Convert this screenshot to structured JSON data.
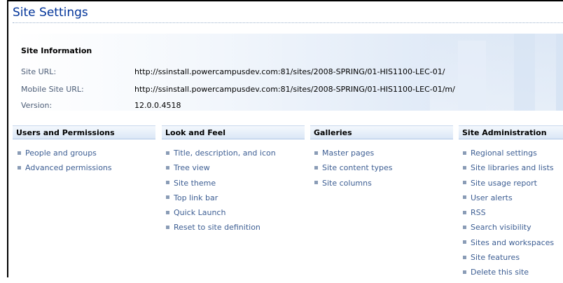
{
  "page": {
    "title": "Site Settings"
  },
  "site_information": {
    "heading": "Site Information",
    "rows": [
      {
        "label": "Site URL:",
        "value": "http://ssinstall.powercampusdev.com:81/sites/2008-SPRING/01-HIS1100-LEC-01/"
      },
      {
        "label": "Mobile Site URL:",
        "value": "http://ssinstall.powercampusdev.com:81/sites/2008-SPRING/01-HIS1100-LEC-01/m/"
      },
      {
        "label": "Version:",
        "value": "12.0.0.4518"
      }
    ]
  },
  "sections": [
    {
      "title": "Users and Permissions",
      "links": [
        "People and groups",
        "Advanced permissions"
      ]
    },
    {
      "title": "Look and Feel",
      "links": [
        "Title, description, and icon",
        "Tree view",
        "Site theme",
        "Top link bar",
        "Quick Launch",
        "Reset to site definition"
      ]
    },
    {
      "title": "Galleries",
      "links": [
        "Master pages",
        "Site content types",
        "Site columns"
      ]
    },
    {
      "title": "Site Administration",
      "links": [
        "Regional settings",
        "Site libraries and lists",
        "Site usage report",
        "User alerts",
        "RSS",
        "Search visibility",
        "Sites and workspaces",
        "Site features",
        "Delete this site"
      ]
    }
  ],
  "colors": {
    "title": "#003399",
    "link": "#3d5e93",
    "header_bg": "#dbe7f6"
  }
}
